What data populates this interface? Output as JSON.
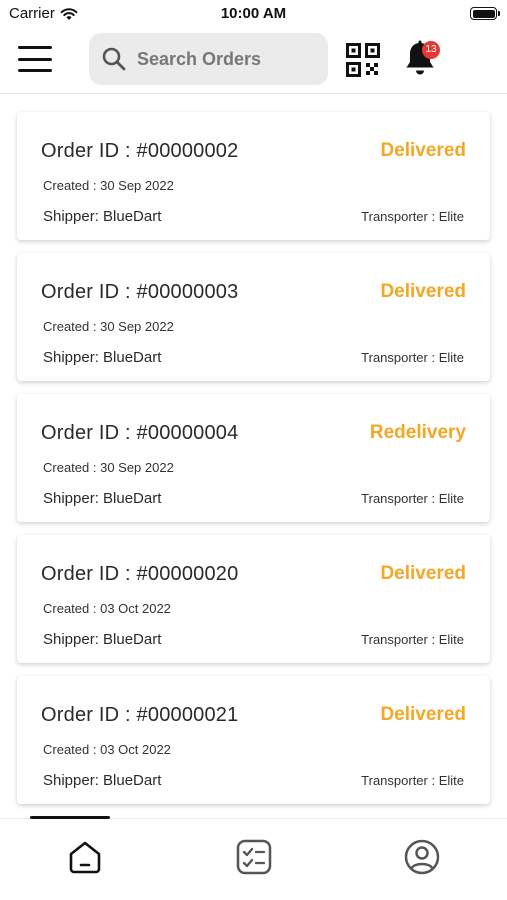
{
  "status_bar": {
    "carrier": "Carrier",
    "time": "10:00 AM"
  },
  "header": {
    "search_placeholder": "Search Orders",
    "notification_count": "13",
    "icons": [
      "menu-icon",
      "search-icon",
      "qr-code-icon",
      "bell-icon"
    ]
  },
  "orders": [
    {
      "id": "Order ID : #00000002",
      "status": "Delivered",
      "created": "Created : 30 Sep 2022",
      "shipper": "Shipper: BlueDart",
      "transporter": "Transporter : Elite"
    },
    {
      "id": "Order ID : #00000003",
      "status": "Delivered",
      "created": "Created : 30 Sep 2022",
      "shipper": "Shipper: BlueDart",
      "transporter": "Transporter : Elite"
    },
    {
      "id": "Order ID : #00000004",
      "status": "Redelivery",
      "created": "Created : 30 Sep 2022",
      "shipper": "Shipper: BlueDart",
      "transporter": "Transporter : Elite"
    },
    {
      "id": "Order ID : #00000020",
      "status": "Delivered",
      "created": "Created : 03 Oct 2022",
      "shipper": "Shipper: BlueDart",
      "transporter": "Transporter : Elite"
    },
    {
      "id": "Order ID : #00000021",
      "status": "Delivered",
      "created": "Created : 03 Oct 2022",
      "shipper": "Shipper: BlueDart",
      "transporter": "Transporter : Elite"
    }
  ],
  "tabs": [
    {
      "icon": "home-icon",
      "active": true
    },
    {
      "icon": "task-list-icon",
      "active": false
    },
    {
      "icon": "profile-icon",
      "active": false
    }
  ],
  "colors": {
    "status_accent": "#f5a623",
    "badge": "#e53935"
  }
}
